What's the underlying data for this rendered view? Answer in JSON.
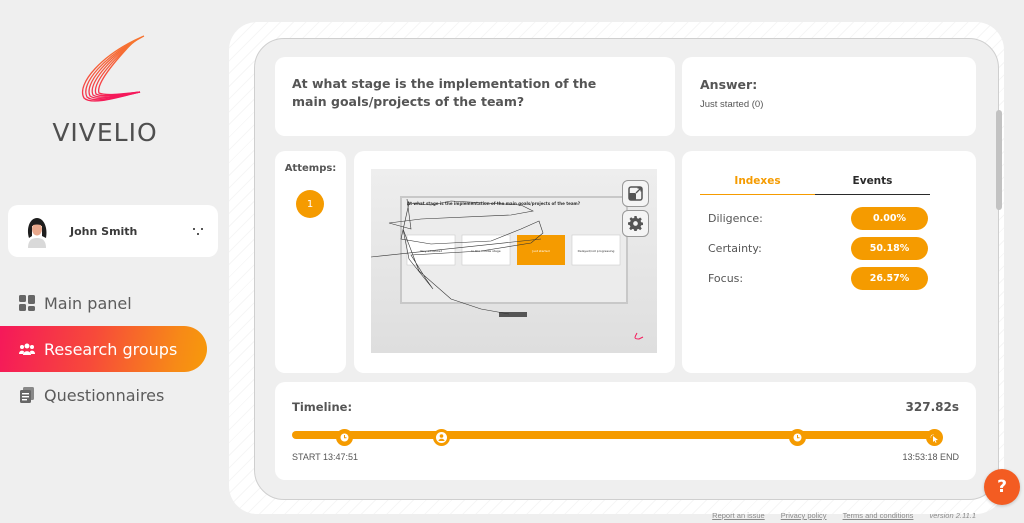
{
  "brand": {
    "name": "VIVELIO",
    "accent": "#f59b00",
    "gradient_start": "#f5185a",
    "gradient_end": "#f79a0a"
  },
  "user": {
    "name": "John Smith",
    "avatar": "avatar-icon",
    "menu_icon": "more-dots-icon"
  },
  "nav": {
    "items": [
      {
        "label": "Main panel",
        "icon": "dashboard-icon",
        "active": false
      },
      {
        "label": "Research groups",
        "icon": "users-icon",
        "active": true
      },
      {
        "label": "Questionnaires",
        "icon": "documents-icon",
        "active": false
      }
    ]
  },
  "question": {
    "text": "At what stage is the implementation of the main goals/projects of the team?"
  },
  "answer": {
    "label": "Answer:",
    "value": "Just started (0)"
  },
  "attempts": {
    "label": "Attemps:",
    "items": [
      "1"
    ]
  },
  "replay": {
    "thumbnail_title": "At what stage is the implementation of the main goals/projects of the team?",
    "options": [
      "Very advanced",
      "In the middle stage",
      "Just started",
      "Delayed/not progressing"
    ],
    "selected_option_index": 2,
    "expand_icon": "expand-icon",
    "settings_icon": "gear-icon"
  },
  "metrics": {
    "tabs": [
      {
        "label": "Indexes",
        "active": true
      },
      {
        "label": "Events",
        "active": false
      }
    ],
    "rows": [
      {
        "label": "Diligence:",
        "value": "0.00%"
      },
      {
        "label": "Certainty:",
        "value": "50.18%"
      },
      {
        "label": "Focus:",
        "value": "26.57%"
      }
    ]
  },
  "timeline": {
    "label": "Timeline:",
    "duration": "327.82s",
    "start": "START 13:47:51",
    "end": "13:53:18 END",
    "markers": [
      {
        "type": "clock-icon",
        "position": 0.08
      },
      {
        "type": "user-icon",
        "position": 0.23
      },
      {
        "type": "clock-icon",
        "position": 0.78
      },
      {
        "type": "click-icon",
        "position": 0.99
      }
    ]
  },
  "help": {
    "label": "?"
  },
  "footer": {
    "links": [
      "Report an issue",
      "Privacy policy",
      "Terms and conditions"
    ],
    "version": "version 2.11.1"
  }
}
